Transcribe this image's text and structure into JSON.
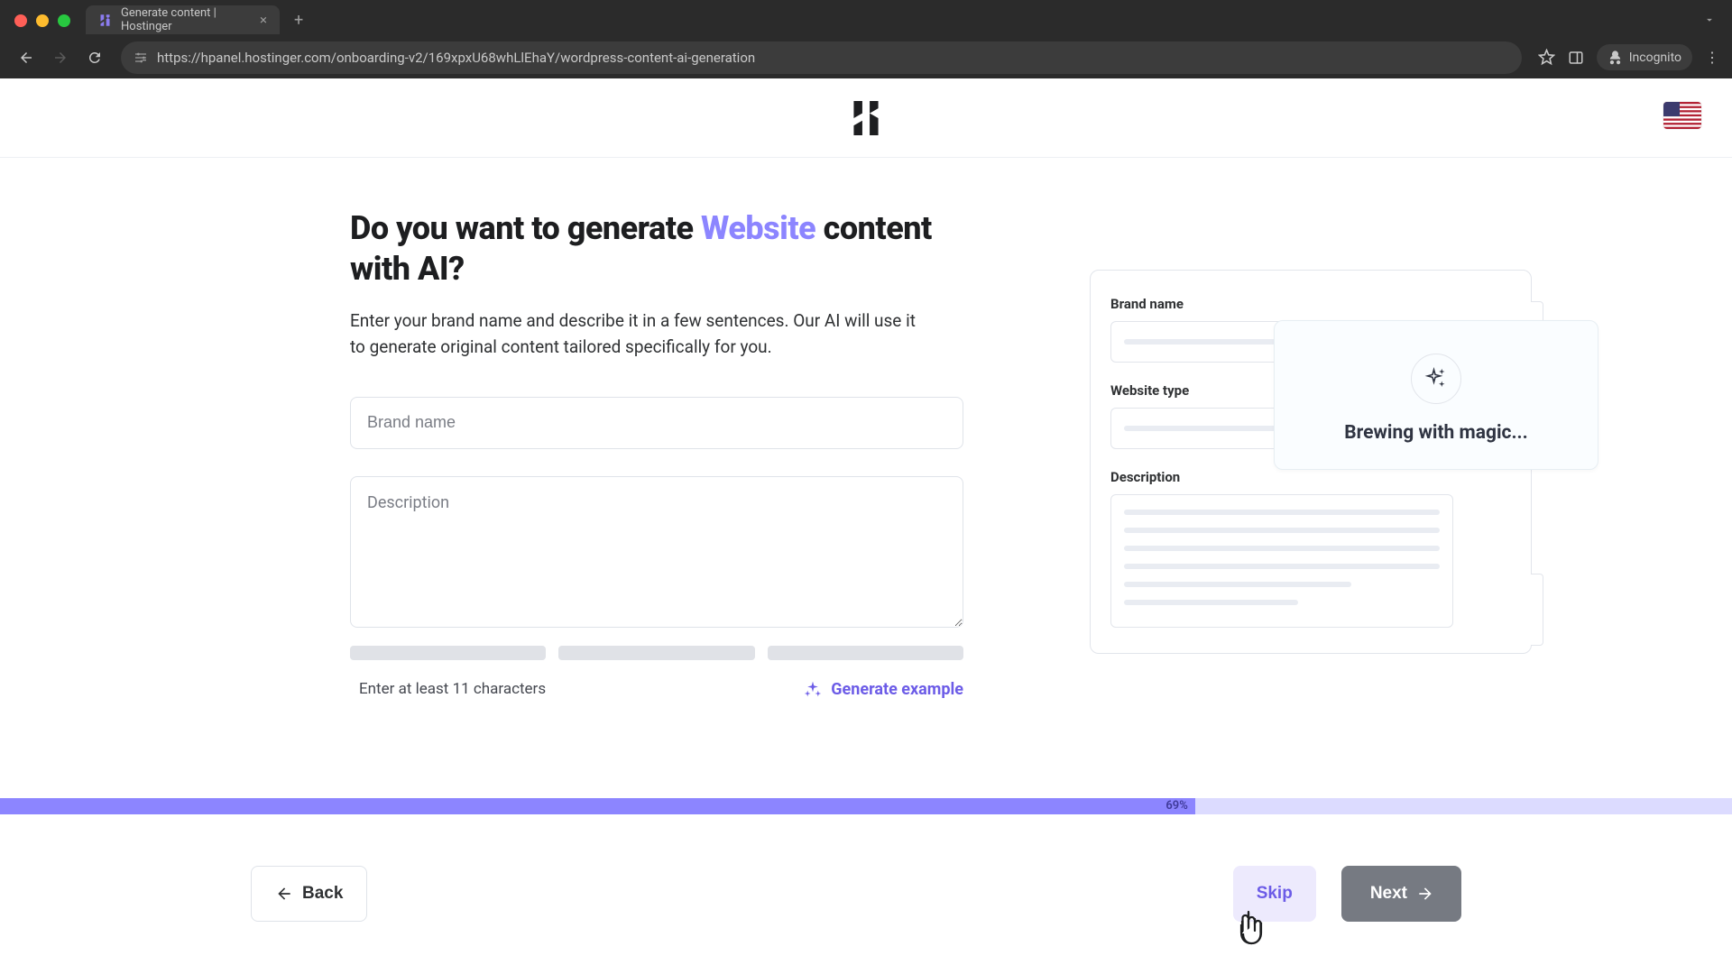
{
  "browser": {
    "tab_title": "Generate content | Hostinger",
    "url": "https://hpanel.hostinger.com/onboarding-v2/169xpxU68whLlEhaY/wordpress-content-ai-generation",
    "incognito_label": "Incognito"
  },
  "heading": {
    "pre": "Do you want to generate ",
    "accent": "Website",
    "post": " content with AI?"
  },
  "subtext": "Enter your brand name and describe it in a few sentences. Our AI will use it to generate original content tailored specifically for you.",
  "form": {
    "brand_placeholder": "Brand name",
    "desc_placeholder": "Description",
    "hint": "Enter at least 11 characters",
    "gen_example": "Generate example"
  },
  "illustration": {
    "brand_label": "Brand name",
    "type_label": "Website type",
    "desc_label": "Description",
    "popover_text": "Brewing with magic..."
  },
  "progress": {
    "percent_label": "69%",
    "percent_value": 69
  },
  "footer": {
    "back": "Back",
    "skip": "Skip",
    "next": "Next"
  }
}
